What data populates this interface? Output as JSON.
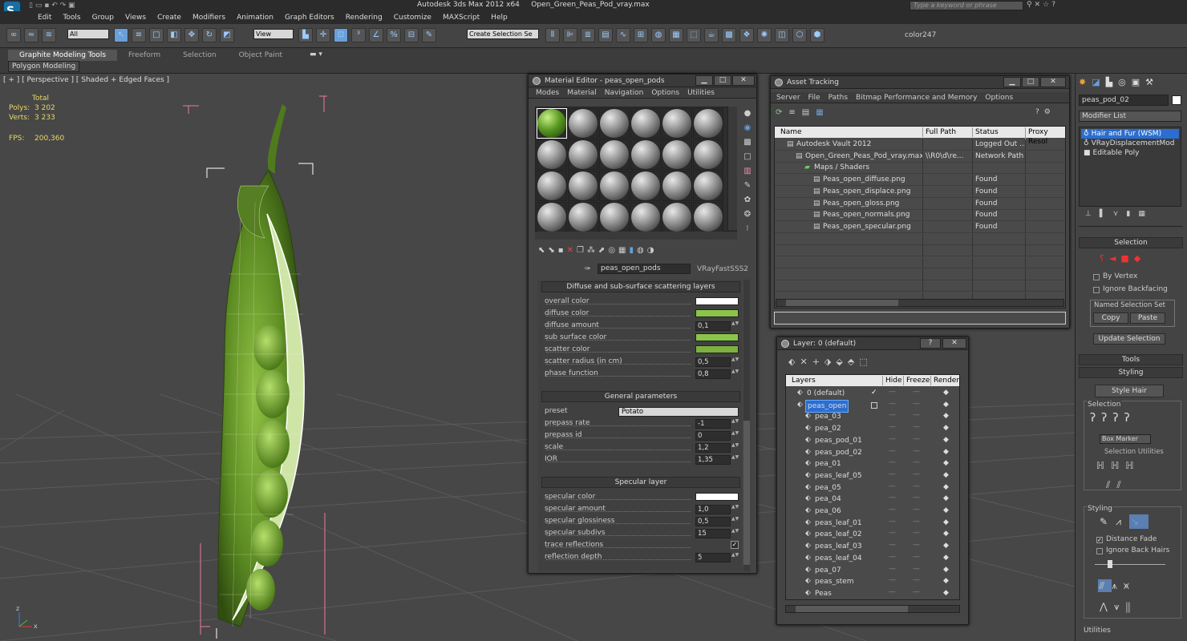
{
  "app": {
    "title": "Autodesk 3ds Max  2012 x64",
    "file": "Open_Green_Peas_Pod_vray.max",
    "search_placeholder": "Type a keyword or phrase"
  },
  "menu": [
    "Edit",
    "Tools",
    "Group",
    "Views",
    "Create",
    "Modifiers",
    "Animation",
    "Graph Editors",
    "Rendering",
    "Customize",
    "MAXScript",
    "Help"
  ],
  "toolbar": {
    "selection_filter": "All",
    "ref_coord": "View",
    "named_selection": "Create Selection Se",
    "color_label": "color247"
  },
  "ribbon": {
    "tabs": [
      "Graphite Modeling Tools",
      "Freeform",
      "Selection",
      "Object Paint"
    ],
    "sub": "Polygon Modeling"
  },
  "viewport": {
    "label": "[ + ] [ Perspective ] [ Shaded + Edged Faces ]",
    "stats": {
      "total": "Total",
      "polys_label": "Polys:",
      "polys": "3 202",
      "verts_label": "Verts:",
      "verts": "3 233",
      "fps_label": "FPS:",
      "fps": "200,360"
    }
  },
  "material_editor": {
    "title": "Material Editor - peas_open_pods",
    "menu": [
      "Modes",
      "Material",
      "Navigation",
      "Options",
      "Utilities"
    ],
    "material_name": "peas_open_pods",
    "material_type": "VRayFastSSS2",
    "rollouts": {
      "diffuse": {
        "title": "Diffuse and sub-surface scattering layers",
        "params": [
          {
            "label": "overall color",
            "kind": "color",
            "color": "#ffffff"
          },
          {
            "label": "diffuse color",
            "kind": "color",
            "color": "#8ac54a"
          },
          {
            "label": "diffuse amount",
            "kind": "num",
            "value": "0,1"
          },
          {
            "label": "sub surface color",
            "kind": "color",
            "color": "#8ac54a"
          },
          {
            "label": "scatter color",
            "kind": "color",
            "color": "#7db040"
          },
          {
            "label": "scatter radius (in cm)",
            "kind": "num",
            "value": "0,5"
          },
          {
            "label": "phase function",
            "kind": "num",
            "value": "0,8"
          }
        ]
      },
      "general": {
        "title": "General parameters",
        "preset_label": "preset",
        "preset_value": "Potato",
        "params": [
          {
            "label": "prepass rate",
            "value": "-1"
          },
          {
            "label": "prepass id",
            "value": "0"
          },
          {
            "label": "scale",
            "value": "1,2"
          },
          {
            "label": "IOR",
            "value": "1,35"
          }
        ]
      },
      "specular": {
        "title": "Specular layer",
        "params": [
          {
            "label": "specular color",
            "kind": "color",
            "color": "#ffffff"
          },
          {
            "label": "specular amount",
            "kind": "num",
            "value": "1,0"
          },
          {
            "label": "specular glossiness",
            "kind": "num",
            "value": "0,5"
          },
          {
            "label": "specular subdivs",
            "kind": "num",
            "value": "15"
          },
          {
            "label": "trace reflections",
            "kind": "check",
            "value": "✓"
          },
          {
            "label": "reflection depth",
            "kind": "num",
            "value": "5"
          }
        ]
      }
    }
  },
  "asset_tracking": {
    "title": "Asset Tracking",
    "menu": [
      "Server",
      "File",
      "Paths",
      "Bitmap Performance and Memory",
      "Options"
    ],
    "columns": [
      "Name",
      "Full Path",
      "Status",
      "Proxy Resol"
    ],
    "rows": [
      {
        "indent": 1,
        "name": "Autodesk Vault 2012",
        "path": "",
        "status": "Logged Out ..."
      },
      {
        "indent": 2,
        "name": "Open_Green_Peas_Pod_vray.max",
        "path": "\\\\R0\\d\\re...",
        "status": "Network Path"
      },
      {
        "indent": 3,
        "name": "Maps / Shaders",
        "path": "",
        "status": ""
      },
      {
        "indent": 4,
        "name": "Peas_open_diffuse.png",
        "path": "",
        "status": "Found"
      },
      {
        "indent": 4,
        "name": "Peas_open_displace.png",
        "path": "",
        "status": "Found"
      },
      {
        "indent": 4,
        "name": "Peas_open_gloss.png",
        "path": "",
        "status": "Found"
      },
      {
        "indent": 4,
        "name": "Peas_open_normals.png",
        "path": "",
        "status": "Found"
      },
      {
        "indent": 4,
        "name": "Peas_open_specular.png",
        "path": "",
        "status": "Found"
      }
    ]
  },
  "layer_manager": {
    "title": "Layer: 0 (default)",
    "help": "?",
    "columns": [
      "Layers",
      "Hide",
      "Freeze",
      "Render"
    ],
    "layers": [
      {
        "name": "0 (default)",
        "indent": 1,
        "active": true
      },
      {
        "name": "peas_open",
        "indent": 0,
        "selected": true
      },
      {
        "name": "pea_03",
        "indent": 2
      },
      {
        "name": "pea_02",
        "indent": 2
      },
      {
        "name": "peas_pod_01",
        "indent": 2
      },
      {
        "name": "peas_pod_02",
        "indent": 2
      },
      {
        "name": "pea_01",
        "indent": 2
      },
      {
        "name": "peas_leaf_05",
        "indent": 2
      },
      {
        "name": "pea_05",
        "indent": 2
      },
      {
        "name": "pea_04",
        "indent": 2
      },
      {
        "name": "pea_06",
        "indent": 2
      },
      {
        "name": "peas_leaf_01",
        "indent": 2
      },
      {
        "name": "peas_leaf_02",
        "indent": 2
      },
      {
        "name": "peas_leaf_03",
        "indent": 2
      },
      {
        "name": "peas_leaf_04",
        "indent": 2
      },
      {
        "name": "pea_07",
        "indent": 2
      },
      {
        "name": "peas_stem",
        "indent": 2
      },
      {
        "name": "Peas",
        "indent": 2
      }
    ]
  },
  "command_panel": {
    "object_name": "peas_pod_02",
    "modifier_list": "Modifier List",
    "stack": [
      {
        "name": "Hair and Fur (WSM)",
        "selected": true
      },
      {
        "name": "VRayDisplacementMod",
        "selected": false
      },
      {
        "name": "Editable Poly",
        "selected": false
      }
    ],
    "selection": {
      "title": "Selection",
      "by_vertex": "By Vertex",
      "ignore_backfacing": "Ignore Backfacing",
      "named_sel": "Named Selection Set",
      "copy": "Copy",
      "paste": "Paste",
      "update": "Update Selection"
    },
    "tools": "Tools",
    "styling": {
      "title": "Styling",
      "style_hair": "Style Hair",
      "selection": "Selection",
      "marker": "Box Marker",
      "sel_utilities": "Selection Utilities",
      "styling": "Styling",
      "distance_fade": "Distance Fade",
      "ignore_back_hairs": "Ignore Back Hairs",
      "utilities": "Utilities"
    }
  }
}
